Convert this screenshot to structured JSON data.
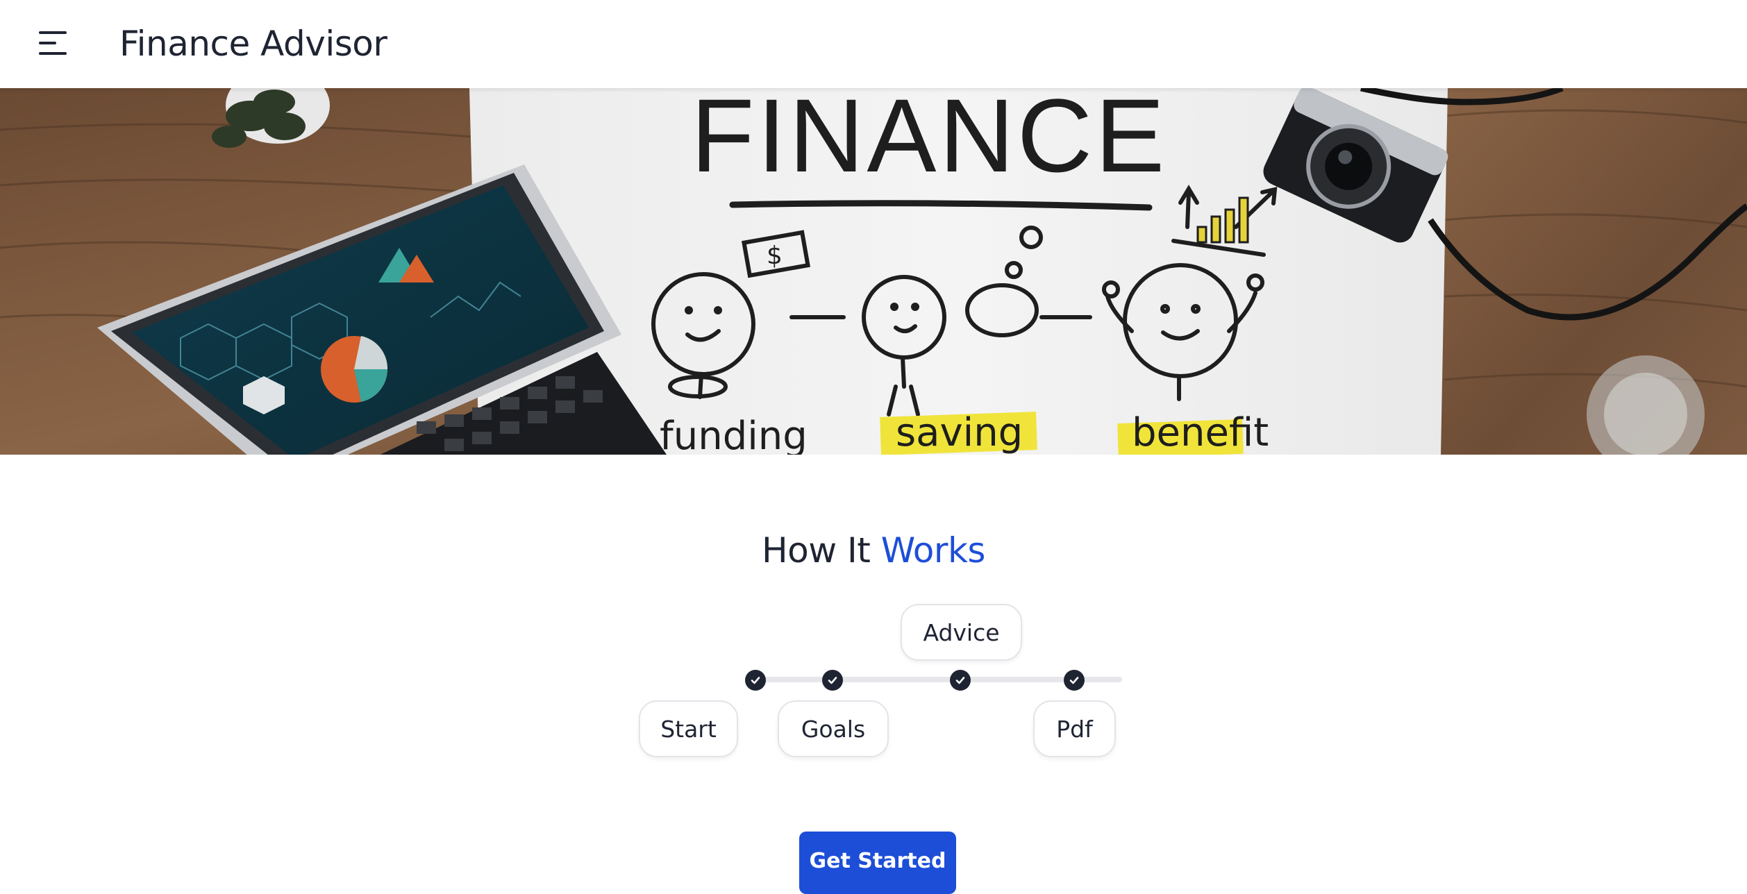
{
  "header": {
    "menu_icon": "hamburger-menu-icon",
    "title": "Finance Advisor"
  },
  "hero": {
    "image_semantic": "finance-hero-banner",
    "board_heading": "FINANCE",
    "board_words": [
      "funding",
      "saving",
      "benefit"
    ]
  },
  "how_it_works": {
    "title_part1": "How It ",
    "title_part2": "Works",
    "accent_color": "#1d4ed8",
    "steps": [
      {
        "label": "Start",
        "icon": "check-icon"
      },
      {
        "label": "Goals",
        "icon": "check-icon"
      },
      {
        "label": "Advice",
        "icon": "check-icon"
      },
      {
        "label": "Pdf",
        "icon": "check-icon"
      }
    ]
  },
  "cta": {
    "label": "Get Started",
    "color": "#1d4ed8"
  }
}
